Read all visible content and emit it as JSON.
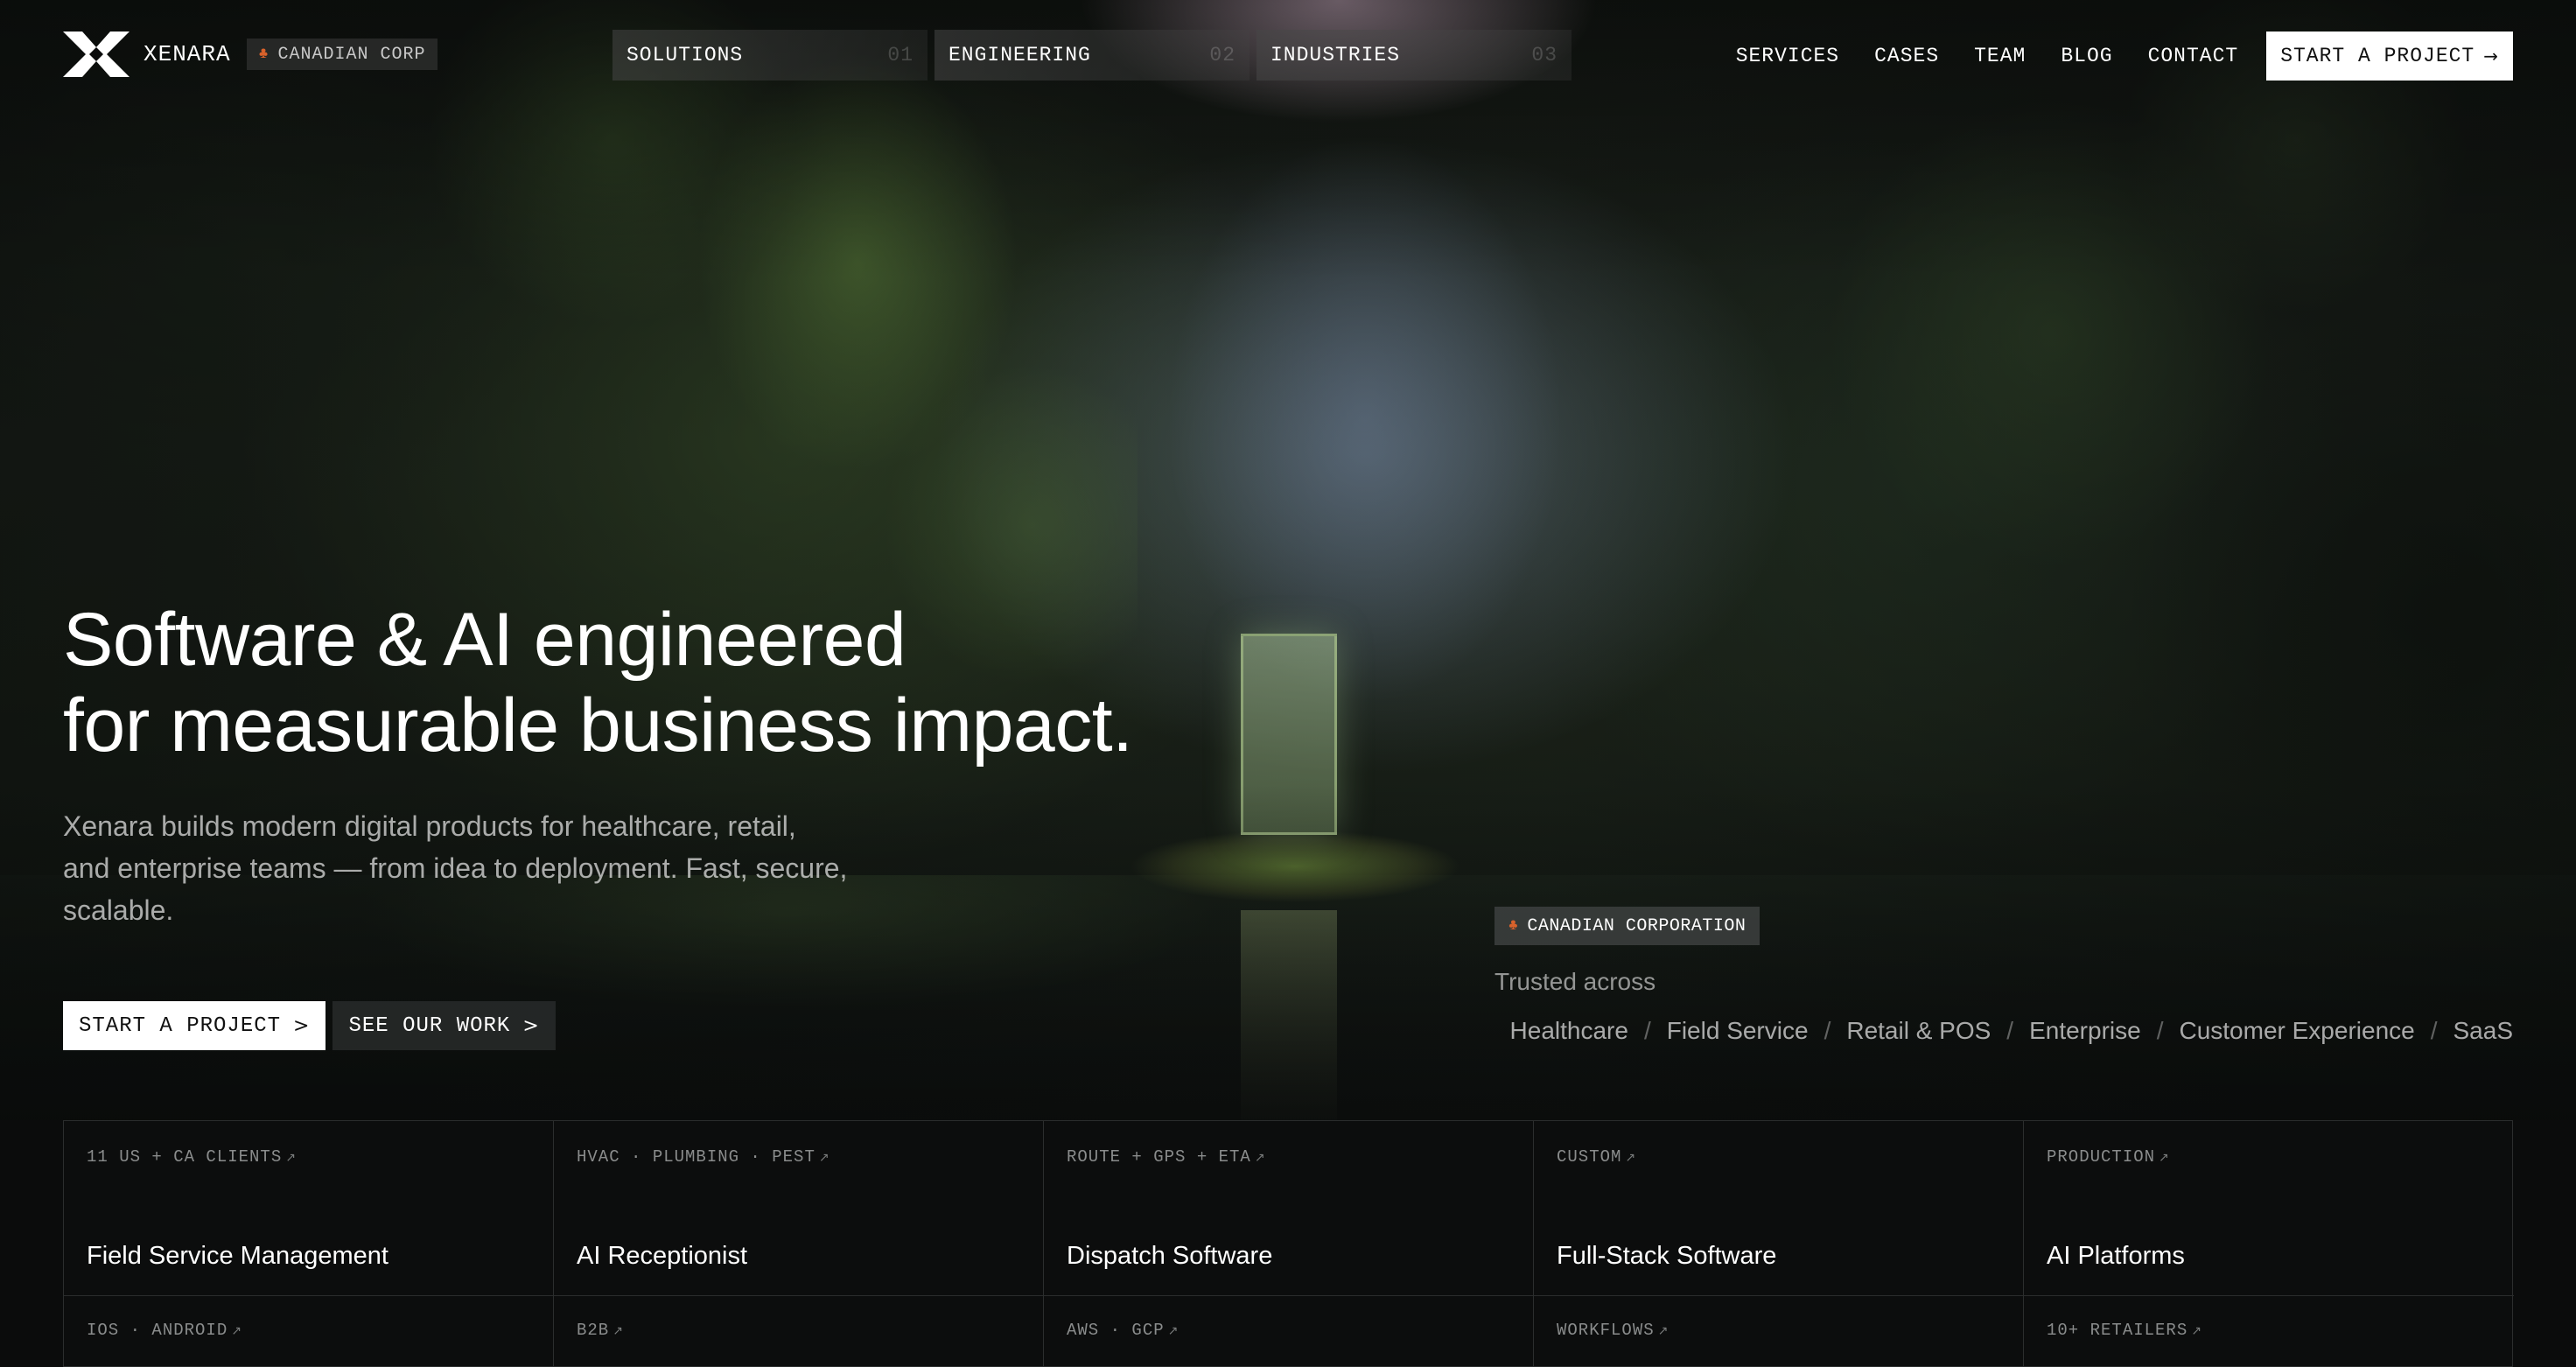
{
  "nav": {
    "brand": "XENARA",
    "corp_badge": "CANADIAN CORP",
    "tabs": [
      {
        "label": "SOLUTIONS",
        "num": "01"
      },
      {
        "label": "ENGINEERING",
        "num": "02"
      },
      {
        "label": "INDUSTRIES",
        "num": "03"
      }
    ],
    "links": [
      "SERVICES",
      "CASES",
      "TEAM",
      "BLOG",
      "CONTACT"
    ],
    "cta": "START A PROJECT",
    "cta_arrow": "→"
  },
  "hero": {
    "headline_line1": "Software & AI engineered",
    "headline_line2": "for measurable business impact.",
    "subcopy": "Xenara builds modern digital products for healthcare, retail, and enterprise teams — from idea to deployment. Fast, secure, scalable.",
    "cta_primary": "START A PROJECT",
    "cta_secondary": "SEE OUR WORK",
    "chevron": ">"
  },
  "trust": {
    "badge": "CANADIAN CORPORATION",
    "label": "Trusted across",
    "industries": [
      "Healthcare",
      "Field Service",
      "Retail & POS",
      "Enterprise",
      "Customer Experience",
      "SaaS"
    ],
    "separator": "/"
  },
  "services": {
    "row1": [
      {
        "tag": "11 US + CA CLIENTS",
        "title": "Field Service Management"
      },
      {
        "tag": "HVAC · PLUMBING · PEST",
        "title": "AI Receptionist"
      },
      {
        "tag": "ROUTE + GPS + ETA",
        "title": "Dispatch Software"
      },
      {
        "tag": "CUSTOM",
        "title": "Full-Stack Software"
      },
      {
        "tag": "PRODUCTION",
        "title": "AI Platforms"
      }
    ],
    "row2": [
      {
        "tag": "IOS · ANDROID"
      },
      {
        "tag": "B2B"
      },
      {
        "tag": "AWS · GCP"
      },
      {
        "tag": "WORKFLOWS"
      },
      {
        "tag": "10+ RETAILERS"
      }
    ],
    "tag_arrow": "↗"
  },
  "icons": {
    "logo": "xenara-logo",
    "maple": "maple-leaf-icon",
    "arrow": "arrow-right-icon",
    "chevron": "chevron-right-icon",
    "external": "external-arrow-icon"
  },
  "colors": {
    "accent_maple": "#d9622b",
    "cta_bg": "#ffffff",
    "page_bg": "#0b0c0c"
  }
}
